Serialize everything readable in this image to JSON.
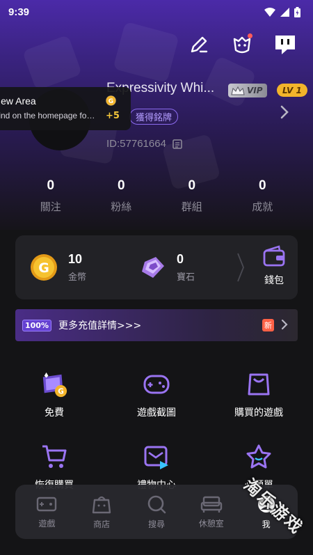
{
  "status_bar": {
    "time": "9:39"
  },
  "profile": {
    "username": "Expressivity Whi...",
    "vip": "VIP",
    "level": "LV 1",
    "title_tag": "獲得銘牌",
    "user_id": "ID:57761664"
  },
  "tooltip": {
    "title": "New  Area",
    "description": "Find on the homepage for t...",
    "reward": "+5"
  },
  "stats": [
    {
      "value": "0",
      "label": "關注"
    },
    {
      "value": "0",
      "label": "粉絲"
    },
    {
      "value": "0",
      "label": "群組"
    },
    {
      "value": "0",
      "label": "成就"
    }
  ],
  "wallet": {
    "coins": {
      "value": "10",
      "label": "金幣"
    },
    "gems": {
      "value": "0",
      "label": "寶石"
    },
    "wallet_label": "錢包"
  },
  "recharge": {
    "badge": "100%",
    "text": "更多充值詳情>>>",
    "new_badge": "新"
  },
  "features": [
    {
      "label": "免費",
      "icon": "free-gift-icon"
    },
    {
      "label": "遊戲截圖",
      "icon": "gamepad-icon"
    },
    {
      "label": "購買的遊戲",
      "icon": "shopping-bag-icon"
    },
    {
      "label": "恢復購買",
      "icon": "cart-icon"
    },
    {
      "label": "禮物中心",
      "icon": "gift-mail-icon"
    },
    {
      "label": "心願單",
      "icon": "star-face-icon"
    }
  ],
  "bottom_nav": [
    {
      "label": "遊戲",
      "icon": "game-console-icon"
    },
    {
      "label": "商店",
      "icon": "shop-icon"
    },
    {
      "label": "搜尋",
      "icon": "search-icon"
    },
    {
      "label": "休憩室",
      "icon": "sofa-icon"
    },
    {
      "label": "我",
      "icon": "profile-icon"
    }
  ],
  "watermark": "淘乐游戏",
  "colors": {
    "accent": "#8d6cf0",
    "gold": "#f3b42b",
    "background": "#141416"
  }
}
